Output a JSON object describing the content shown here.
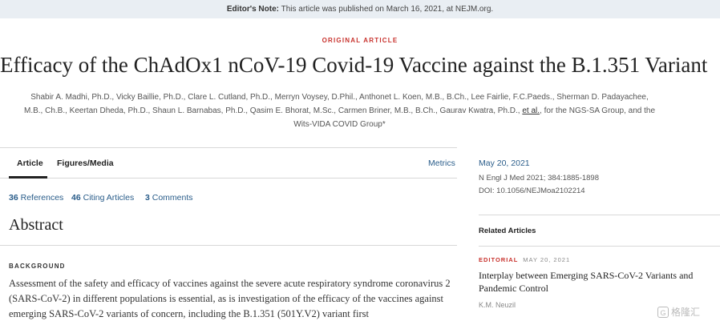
{
  "editor_note": {
    "label": "Editor's Note:",
    "text": " This article was published on March 16, 2021, at NEJM.org."
  },
  "article": {
    "kicker": "ORIGINAL ARTICLE",
    "title": "Efficacy of the ChAdOx1 nCoV-19 Covid-19 Vaccine against the B.1.351 Variant",
    "authors_line1": "Shabir A. Madhi, Ph.D., Vicky Baillie, Ph.D., Clare L. Cutland, Ph.D., Merryn Voysey, D.Phil., Anthonet L. Koen, M.B., B.Ch., Lee Fairlie, F.C.Paeds., Sherman D. Padayachee,",
    "authors_line2": "M.B., Ch.B., Keertan Dheda, Ph.D., Shaun L. Barnabas, Ph.D., Qasim E. Bhorat, M.Sc., Carmen Briner, M.B., B.Ch., Gaurav Kwatra, Ph.D., ",
    "authors_etal": "et al.",
    "authors_line2_end": ", for the NGS-SA Group, and the",
    "authors_line3": "Wits-VIDA COVID Group*"
  },
  "tabs": {
    "article": "Article",
    "figures": "Figures/Media",
    "metrics": "Metrics"
  },
  "stats": {
    "references_count": "36",
    "references_label": " References",
    "citing_count": "46",
    "citing_label": " Citing Articles",
    "comments_count": "3",
    "comments_label": " Comments"
  },
  "abstract": {
    "heading": "Abstract",
    "section": "BACKGROUND",
    "text": "Assessment of the safety and efficacy of vaccines against the severe acute respiratory syndrome coronavirus 2 (SARS-CoV-2) in different populations is essential, as is investigation of the efficacy of the vaccines against emerging SARS-CoV-2 variants of concern, including the B.1.351 (501Y.V2) variant first"
  },
  "sidebar": {
    "date": "May 20, 2021",
    "citation1": "N Engl J Med 2021; 384:1885-1898",
    "citation2": "DOI: 10.1056/NEJMoa2102214",
    "related_heading": "Related Articles",
    "related": {
      "type": "EDITORIAL",
      "date": "MAY 20, 2021",
      "title": "Interplay between Emerging SARS-CoV-2 Variants and Pandemic Control",
      "author": "K.M. Neuzil"
    }
  },
  "watermark": {
    "logo": "G",
    "text": "格隆汇"
  }
}
